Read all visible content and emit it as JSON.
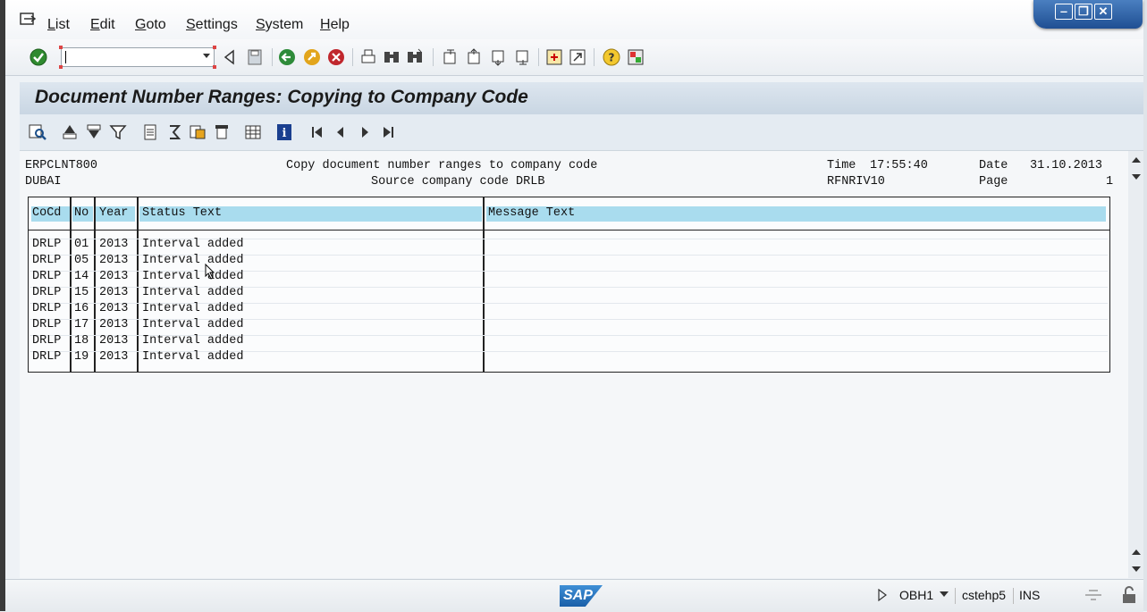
{
  "menu": {
    "items": [
      {
        "label": "List",
        "ul": "L",
        "rest": "ist"
      },
      {
        "label": "Edit",
        "ul": "E",
        "rest": "dit"
      },
      {
        "label": "Goto",
        "ul": "G",
        "rest": "oto"
      },
      {
        "label": "Settings",
        "ul": "S",
        "rest": "ettings"
      },
      {
        "label": "System",
        "ul": "S",
        "rest": "ystem"
      },
      {
        "label": "Help",
        "ul": "H",
        "rest": "elp"
      }
    ]
  },
  "window_controls": {
    "minimize": "‒",
    "restore": "❐",
    "close": "✕"
  },
  "title": "Document Number Ranges: Copying to Company Code",
  "report_header": {
    "system": "ERPCLNT800",
    "location": "DUBAI",
    "heading": "Copy document number ranges to company code",
    "subheading": "Source company code DRLB",
    "time_label": "Time",
    "time": "17:55:40",
    "program": "RFNRIV10",
    "date_label": "Date",
    "date": "31.10.2013",
    "page_label": "Page",
    "page": "1"
  },
  "table": {
    "columns": [
      "CoCd",
      "No",
      "Year",
      "Status Text",
      "Message Text"
    ],
    "rows": [
      [
        "DRLP",
        "01",
        "2013",
        "Interval added"
      ],
      [
        "DRLP",
        "05",
        "2013",
        "Interval added"
      ],
      [
        "DRLP",
        "14",
        "2013",
        "Interval added"
      ],
      [
        "DRLP",
        "15",
        "2013",
        "Interval added"
      ],
      [
        "DRLP",
        "16",
        "2013",
        "Interval added"
      ],
      [
        "DRLP",
        "17",
        "2013",
        "Interval added"
      ],
      [
        "DRLP",
        "18",
        "2013",
        "Interval added"
      ],
      [
        "DRLP",
        "19",
        "2013",
        "Interval added"
      ]
    ]
  },
  "status": {
    "logo": "SAP",
    "system": "OBH1",
    "server": "cstehp5",
    "mode": "INS"
  },
  "colors": {
    "header_fill": "#a9dcee",
    "title_bg": "#c9d6e3",
    "accent_blue": "#1f4f93"
  }
}
